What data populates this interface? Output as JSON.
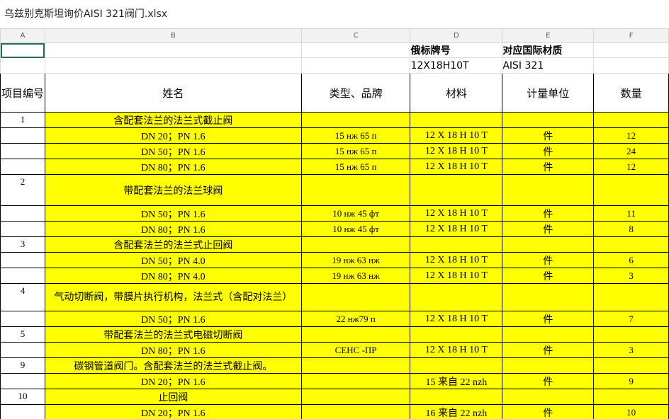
{
  "window": {
    "title": "乌兹别克斯坦询价AISI 321阀门.xlsx"
  },
  "columns": [
    "A",
    "B",
    "C",
    "D",
    "E",
    "F"
  ],
  "meta": {
    "row1": {
      "d": "俄标牌号",
      "e": "对应国际材质"
    },
    "row2": {
      "d": "12X18H10T",
      "e": "AISI 321"
    }
  },
  "header": {
    "a": "项目编号",
    "b": "姓名",
    "c": "类型、品牌",
    "d": "材料",
    "e": "计量单位",
    "f": "数量"
  },
  "rows": [
    {
      "a": "1",
      "b": "含配套法兰的法兰式截止阀",
      "c": "",
      "d": "",
      "e": "",
      "f": ""
    },
    {
      "a": "",
      "b": "DN 20；PN 1.6",
      "c": "15 нж 65 п",
      "d": "12 X 18 H 10 T",
      "e": "件",
      "f": "12"
    },
    {
      "a": "",
      "b": "DN 50；PN 1.6",
      "c": "15 нж 65 п",
      "d": "12 X 18 H 10 T",
      "e": "件",
      "f": "24"
    },
    {
      "a": "",
      "b": "DN 80；PN 1.6",
      "c": "15 нж 65 п",
      "d": "12 X 18 H 10 T",
      "e": "件",
      "f": "12"
    },
    {
      "a": "2",
      "b": "带配套法兰的法兰球阀",
      "c": "",
      "d": "",
      "e": "",
      "f": ""
    },
    {
      "a": "",
      "b": "DN 50；PN 1.6",
      "c": "10 нж 45 фт",
      "d": "12 X 18 H 10 T",
      "e": "件",
      "f": "11"
    },
    {
      "a": "",
      "b": "DN 80；PN 1.6",
      "c": "10 нж 45 фт",
      "d": "12 X 18 H 10 T",
      "e": "件",
      "f": "8"
    },
    {
      "a": "3",
      "b": "含配套法兰的法兰式止回阀",
      "c": "",
      "d": "",
      "e": "",
      "f": ""
    },
    {
      "a": "",
      "b": "DN 50；PN 4.0",
      "c": "19 нж 63 нж",
      "d": "12 X 18 H 10 T",
      "e": "件",
      "f": "6"
    },
    {
      "a": "",
      "b": "DN 80；PN 4.0",
      "c": "19 нж 63 нж",
      "d": "12 X 18 H 10 T",
      "e": "件",
      "f": "3"
    },
    {
      "a": "4",
      "b": "气动切断阀，带膜片执行机构，法兰式（含配对法兰）",
      "c": "",
      "d": "",
      "e": "",
      "f": ""
    },
    {
      "a": "",
      "b": "DN 50；PN 1.6",
      "c": "22 нж79 п",
      "d": "12 X 18 H 10 T",
      "e": "件",
      "f": "7"
    },
    {
      "a": "5",
      "b": "带配套法兰的法兰式电磁切断阀",
      "c": "",
      "d": "",
      "e": "",
      "f": ""
    },
    {
      "a": "",
      "b": "DN 80；PN 1.6",
      "c": "СЕНС -ПР",
      "d": "12 X 18 H 10 T",
      "e": "件",
      "f": "3"
    },
    {
      "a": "9",
      "b": "碳钢管道阀门。含配套法兰的法兰式截止阀。",
      "c": "",
      "d": "",
      "e": "",
      "f": ""
    },
    {
      "a": "",
      "b": "DN 20；PN 1.6",
      "c": "",
      "d": "15 来自 22 nzh",
      "e": "件",
      "f": "9"
    },
    {
      "a": "10",
      "b": "止回阀",
      "c": "",
      "d": "",
      "e": "",
      "f": ""
    },
    {
      "a": "",
      "b": "DN 20；PN 1.6",
      "c": "",
      "d": "16 来自 22 nzh",
      "e": "件",
      "f": "10"
    }
  ]
}
